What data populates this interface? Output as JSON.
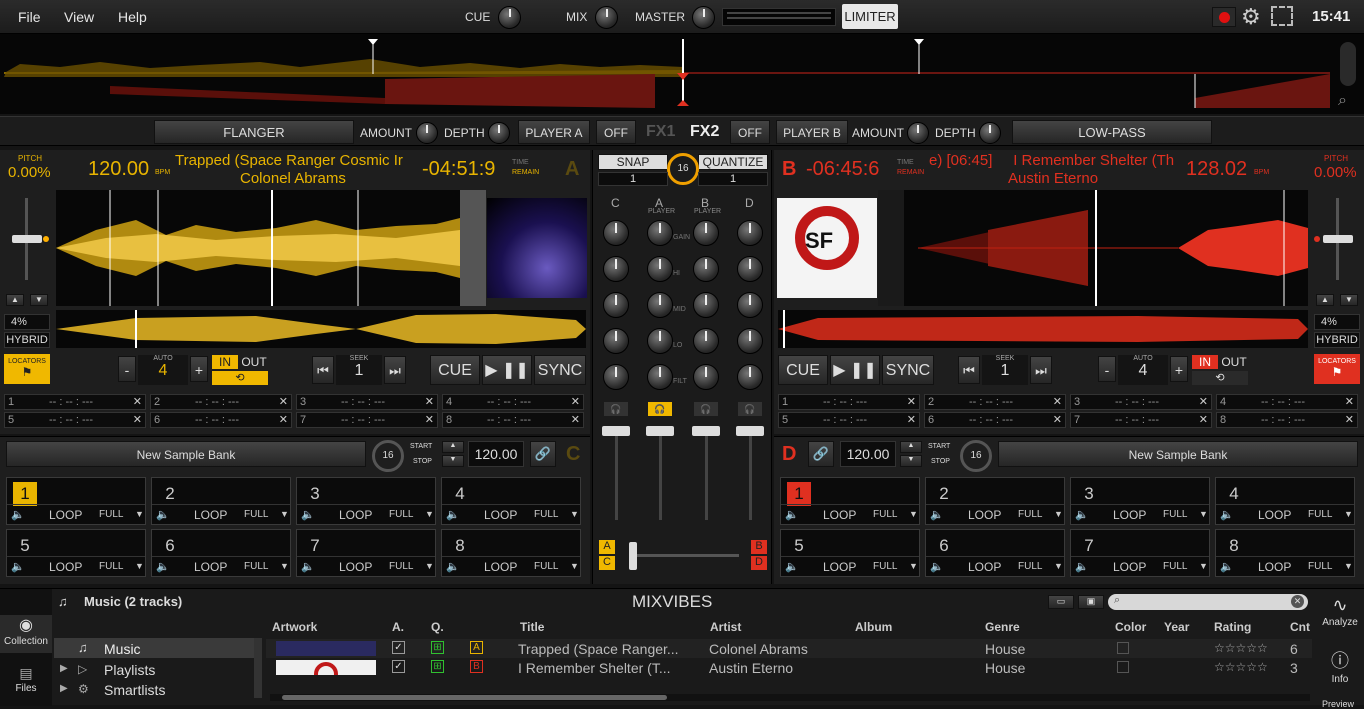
{
  "menu": {
    "file": "File",
    "view": "View",
    "help": "Help"
  },
  "top": {
    "cue": "CUE",
    "mix": "MIX",
    "master": "MASTER",
    "limiter": "LIMITER",
    "clock": "15:41"
  },
  "fx1": {
    "effect": "FLANGER",
    "amount": "AMOUNT",
    "depth": "DEPTH",
    "player": "PLAYER A",
    "off": "OFF",
    "label": "FX1"
  },
  "fx2": {
    "label": "FX2",
    "off": "OFF",
    "player": "PLAYER B",
    "amount": "AMOUNT",
    "depth": "DEPTH",
    "effect": "LOW-PASS"
  },
  "deckA": {
    "pitch_label": "PITCH",
    "pitch": "0.00%",
    "bpm": "120.00",
    "bpm_unit": "BPM",
    "title": "Trapped (Space Ranger Cosmic Ir",
    "artist": "Colonel Abrams",
    "time": "-04:51:9",
    "time_l1": "TIME",
    "time_l2": "REMAIN",
    "letter": "A",
    "range": "4%",
    "mode": "HYBRID",
    "locators": "LOCATORS",
    "auto_label": "AUTO",
    "auto": "4",
    "in": "IN",
    "out": "OUT",
    "seek_label": "SEEK",
    "seek": "1",
    "cue": "CUE",
    "sync": "SYNC",
    "cues": [
      "1",
      "2",
      "3",
      "4",
      "5",
      "6",
      "7",
      "8"
    ],
    "cue_time": "-- : -- : ---",
    "sampler": {
      "bank": "New Sample Bank",
      "beats": "16",
      "start": "START",
      "stop": "STOP",
      "bpm": "120.00",
      "letter": "C"
    },
    "pads": [
      "1",
      "2",
      "3",
      "4",
      "5",
      "6",
      "7",
      "8"
    ],
    "loop": "LOOP",
    "full": "FULL"
  },
  "deckB": {
    "pitch_label": "PITCH",
    "pitch": "0.00%",
    "bpm": "128.02",
    "bpm_unit": "BPM",
    "title": "e) [06:45]     I Remember Shelter (Th",
    "artist": "Austin Eterno",
    "time": "-06:45:6",
    "time_l1": "TIME",
    "time_l2": "REMAIN",
    "letter": "B",
    "range": "4%",
    "mode": "HYBRID",
    "locators": "LOCATORS",
    "auto_label": "AUTO",
    "auto": "4",
    "in": "IN",
    "out": "OUT",
    "seek_label": "SEEK",
    "seek": "1",
    "cue": "CUE",
    "sync": "SYNC",
    "cues": [
      "1",
      "2",
      "3",
      "4",
      "5",
      "6",
      "7",
      "8"
    ],
    "cue_time": "-- : -- : ---",
    "sampler": {
      "bank": "New Sample Bank",
      "beats": "16",
      "start": "START",
      "stop": "STOP",
      "bpm": "120.00",
      "letter": "D"
    },
    "pads": [
      "1",
      "2",
      "3",
      "4",
      "5",
      "6",
      "7",
      "8"
    ],
    "loop": "LOOP",
    "full": "FULL"
  },
  "mixer": {
    "snap": "SNAP",
    "quantize": "QUANTIZE",
    "beats": "16",
    "snap_val": "1",
    "quant_val": "1",
    "channels": [
      "C",
      "A",
      "B",
      "D"
    ],
    "player_sub": "PLAYER",
    "rows": [
      "GAIN",
      "HI",
      "MID",
      "LO",
      "FILT"
    ],
    "xf_left_top": "A",
    "xf_left_bot": "C",
    "xf_right_top": "B",
    "xf_right_bot": "D"
  },
  "browser": {
    "header": "Music (2 tracks)",
    "logo": "MIXVIBES",
    "side_collection": "Collection",
    "side_files": "Files",
    "tree": [
      "Music",
      "Playlists",
      "Smartlists"
    ],
    "analyze": "Analyze",
    "info": "Info",
    "preview": "Preview",
    "columns": [
      "Artwork",
      "A.",
      "Q.",
      "Title",
      "Artist",
      "Album",
      "Genre",
      "Color",
      "Year",
      "Rating",
      "Cnt"
    ],
    "rows": [
      {
        "deck": "A",
        "title": "Trapped (Space Ranger...",
        "artist": "Colonel Abrams",
        "album": "",
        "genre": "House",
        "year": "",
        "rating": "☆☆☆☆☆",
        "count": "6"
      },
      {
        "deck": "B",
        "title": "I Remember Shelter (T...",
        "artist": "Austin Eterno",
        "album": "",
        "genre": "House",
        "year": "",
        "rating": "☆☆☆☆☆",
        "count": "3"
      }
    ]
  },
  "colors": {
    "deckA": "#e8b400",
    "deckB": "#e03020"
  }
}
